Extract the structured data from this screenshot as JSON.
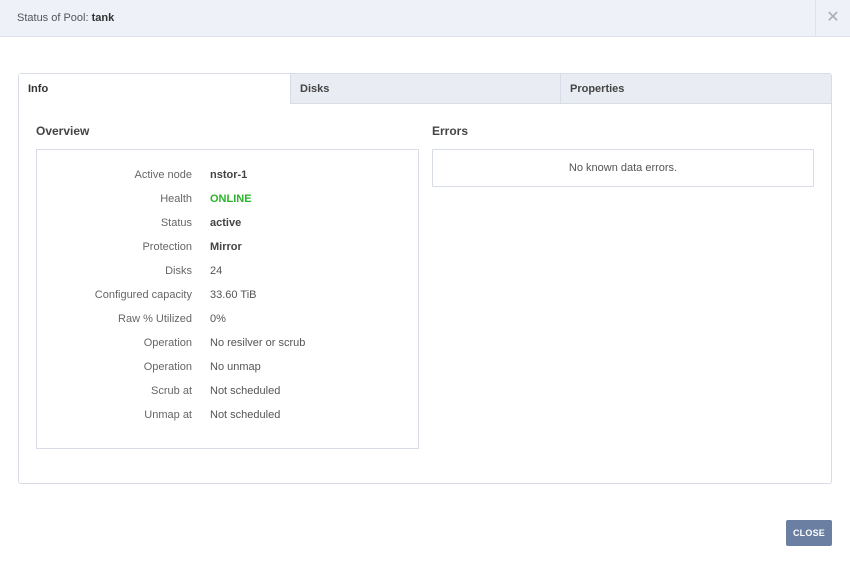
{
  "header": {
    "title_prefix": "Status of Pool: ",
    "pool_name": "tank",
    "close_glyph": "✕"
  },
  "tabs": [
    {
      "label": "Info",
      "active": true
    },
    {
      "label": "Disks",
      "active": false
    },
    {
      "label": "Properties",
      "active": false
    }
  ],
  "overview": {
    "title": "Overview",
    "rows": [
      {
        "label": "Active node",
        "value": "nstor-1"
      },
      {
        "label": "Health",
        "value": "ONLINE"
      },
      {
        "label": "Status",
        "value": "active"
      },
      {
        "label": "Protection",
        "value": "Mirror"
      },
      {
        "label": "Disks",
        "value": "24"
      },
      {
        "label": "Configured capacity",
        "value": "33.60 TiB"
      },
      {
        "label": "Raw % Utilized",
        "value": "0%"
      },
      {
        "label": "Operation",
        "value": "No resilver or scrub"
      },
      {
        "label": "Operation",
        "value": "No unmap"
      },
      {
        "label": "Scrub at",
        "value": "Not scheduled"
      },
      {
        "label": "Unmap at",
        "value": "Not scheduled"
      }
    ]
  },
  "errors": {
    "title": "Errors",
    "message": "No known data errors."
  },
  "footer": {
    "close_label": "CLOSE"
  },
  "colors": {
    "header_bg": "#eef1f8",
    "online": "#2ab42a",
    "close_button_bg": "#6b7fa3"
  }
}
